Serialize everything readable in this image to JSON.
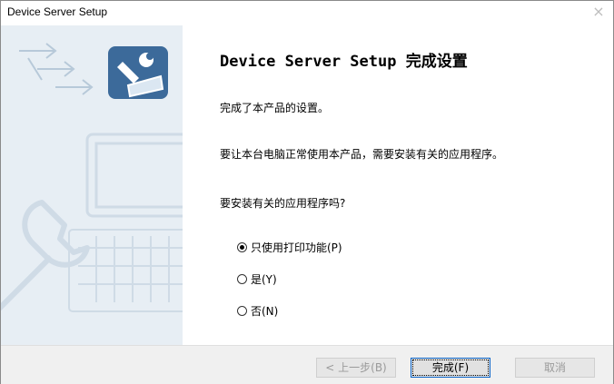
{
  "window": {
    "title": "Device Server Setup",
    "close_glyph": "×"
  },
  "content": {
    "heading": "Device Server Setup 完成设置",
    "line1": "完成了本产品的设置。",
    "line2": "要让本台电脑正常使用本产品，需要安装有关的应用程序。",
    "question": "要安装有关的应用程序吗?"
  },
  "options": [
    {
      "label": "只使用打印功能(P)",
      "selected": true
    },
    {
      "label": "是(Y)",
      "selected": false
    },
    {
      "label": "否(N)",
      "selected": false
    }
  ],
  "buttons": {
    "back": "< 上一步(B)",
    "finish": "完成(F)",
    "cancel": "取消"
  },
  "colors": {
    "sidebar_bg": "#e7eef4",
    "app_icon_bg": "#3c6a9a",
    "footer_bg": "#f0f0f0"
  }
}
